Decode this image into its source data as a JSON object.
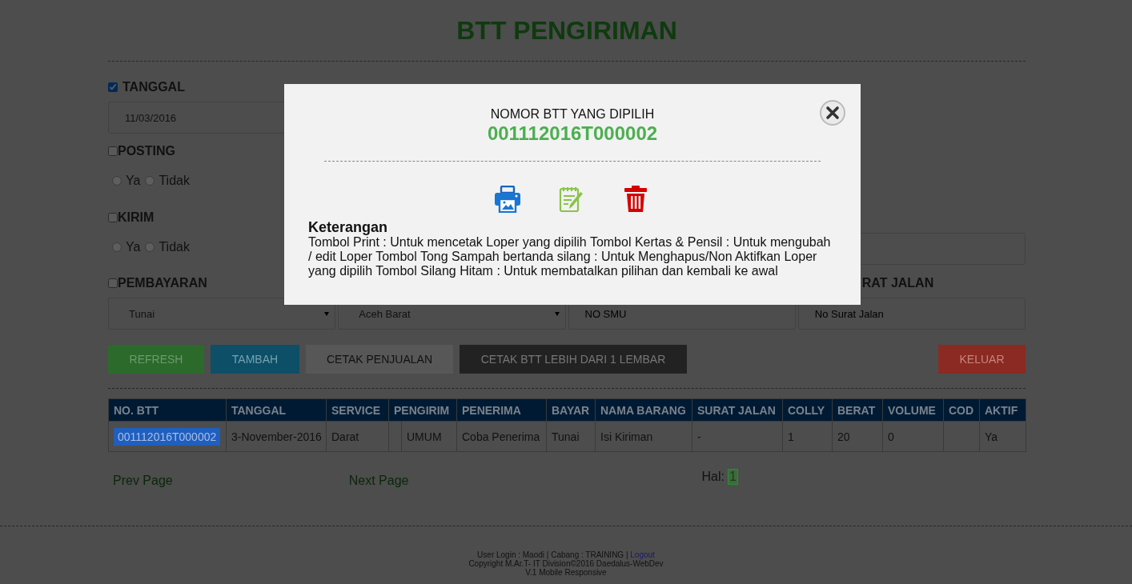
{
  "title": "BTT PENGIRIMAN",
  "filters": [
    {
      "kind": "date",
      "label": "TANGGAL",
      "checked": true,
      "value": "11/03/2016"
    },
    {
      "kind": "radio",
      "label": "POSTING",
      "checked": false,
      "options": [
        {
          "label": "Ya",
          "selected": false
        },
        {
          "label": "Tidak",
          "selected": false
        }
      ]
    },
    {
      "kind": "radio",
      "label": "KIRIM",
      "checked": false,
      "options": [
        {
          "label": "Ya",
          "selected": false
        },
        {
          "label": "Tidak",
          "selected": false
        }
      ]
    }
  ],
  "payment": {
    "label": "PEMBAYARAN",
    "checked": false
  },
  "column_4_label": "RAT JALAN",
  "selects": [
    "Tunai",
    "Aceh Barat"
  ],
  "inputs": [
    {
      "placeholder": "NO SMU"
    },
    {
      "placeholder": "No Surat Jalan"
    }
  ],
  "buttons": [
    {
      "kind": "refresh",
      "label": "REFRESH"
    },
    {
      "kind": "add",
      "label": "TAMBAH"
    },
    {
      "kind": "print_sales",
      "label": "CETAK PENJUALAN"
    },
    {
      "kind": "print_multi",
      "label": "CETAK BTT LEBIH DARI 1 LEMBAR"
    },
    {
      "kind": "exit",
      "label": "KELUAR"
    }
  ],
  "table": {
    "columns": [
      "NO. BTT",
      "TANGGAL",
      "SERVICE",
      "PENGIRIM",
      "PENERIMA",
      "BAYAR",
      "NAMA BARANG",
      "SURAT JALAN",
      "COLLY",
      "BERAT",
      "VOLUME",
      "COD",
      "AKTIF"
    ],
    "rows": [
      {
        "selected": true,
        "cells": [
          "001112016T000002",
          "3-November-2016",
          "Darat",
          "UMUM",
          "Coba Penerima",
          "Tunai",
          "Isi Kiriman",
          "-",
          "1",
          "20",
          "0",
          "",
          "Ya"
        ]
      }
    ]
  },
  "pagination": {
    "prev": "Prev Page",
    "next": "Next Page",
    "label": "Hal:",
    "pages": [
      {
        "label": "1",
        "selected": true
      }
    ]
  },
  "footer": {
    "line_1": "User Login : Maodi | Cabang : TRAINING |",
    "link": "Logout",
    "line_2": "Copyright M.Ar.T- IT Division©2016 Daedalus-WebDev",
    "line_3": "V.1 Mobile Responsive"
  },
  "modal": {
    "heading": "NOMOR BTT YANG DIPILIH",
    "number": "001112016T000002",
    "note_title": "Keterangan",
    "note": "Tombol Print : Untuk mencetak Loper yang dipilih Tombol Kertas & Pensil : Untuk mengubah / edit Loper Tombol Tong Sampah bertanda silang : Untuk Menghapus/Non Aktifkan Loper yang dipilih Tombol Silang Hitam : Untuk membatalkan pilihan dan kembali ke awal"
  }
}
